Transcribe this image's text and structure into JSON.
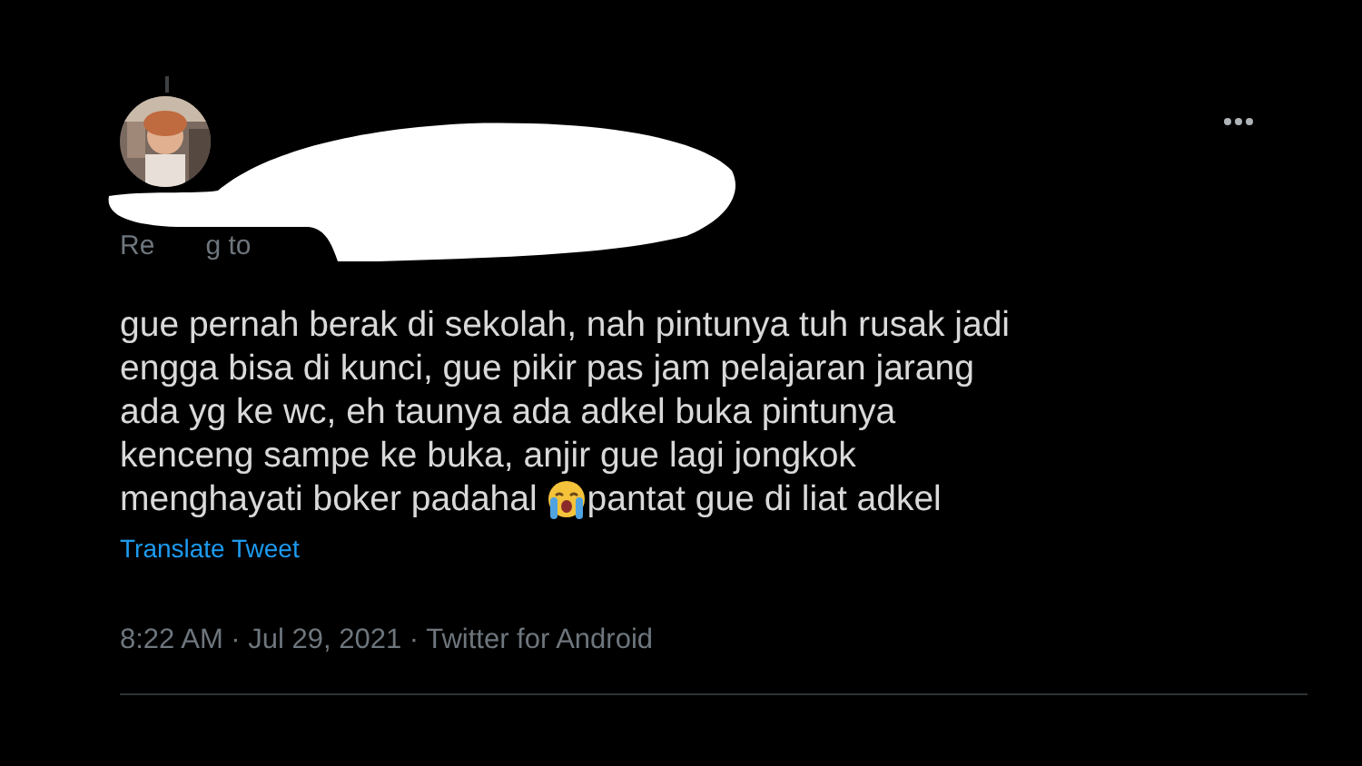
{
  "tweet": {
    "reply_fragments": [
      "Re",
      "g to"
    ],
    "text_lines": [
      "gue pernah berak di sekolah, nah pintunya tuh rusak jadi",
      "engga bisa di kunci, gue pikir pas jam pelajaran jarang",
      "ada yg ke wc, eh taunya ada adkel buka pintunya",
      "kenceng sampe ke buka, anjir gue lagi jongkok"
    ],
    "last_line_before": "menghayati boker padahal ",
    "last_line_after": "pantat gue di liat adkel",
    "translate_link": "Translate Tweet",
    "meta": "8:22 AM · Jul 29, 2021 · Twitter for Android"
  }
}
